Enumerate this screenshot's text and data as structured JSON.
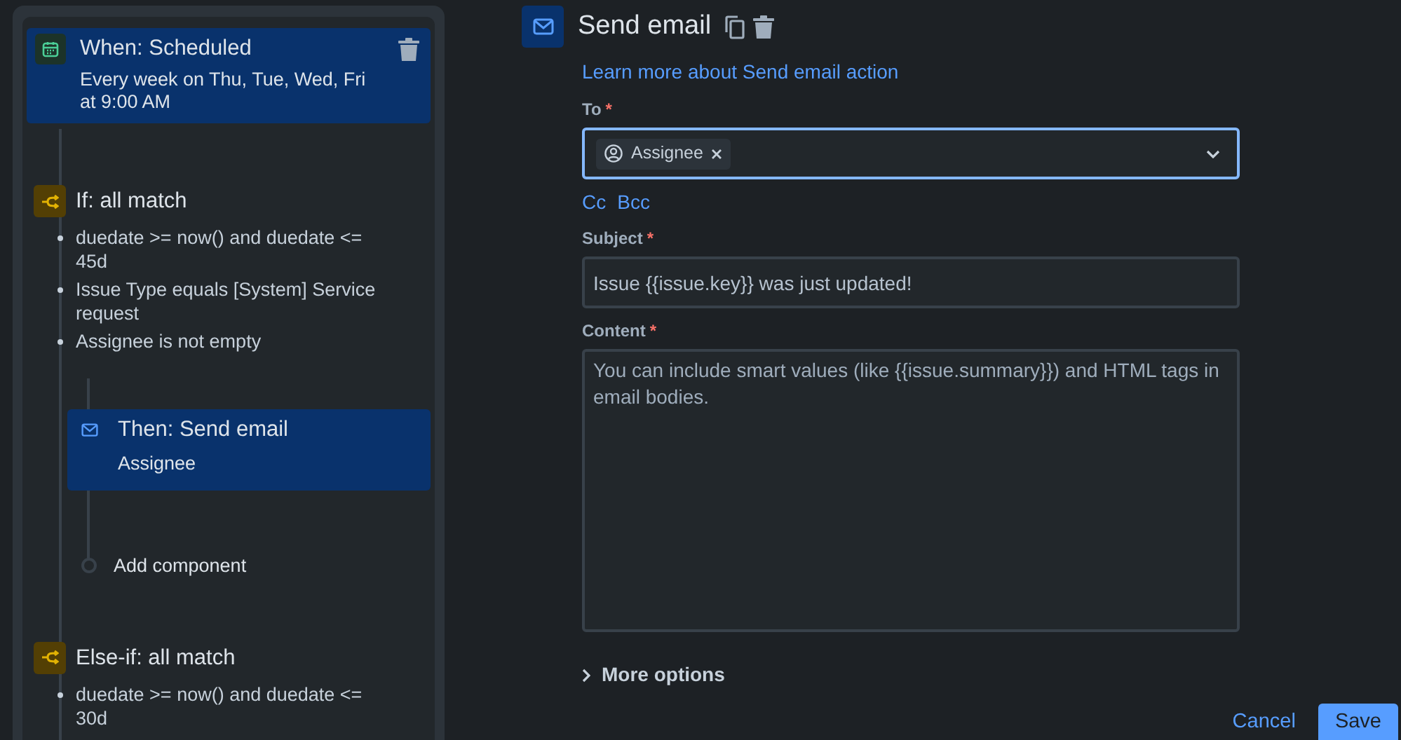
{
  "rule": {
    "components": [
      {
        "kind": "trigger",
        "title": "When: Scheduled",
        "description": "Every week on Thu, Tue, Wed, Fri at 9:00 AM"
      },
      {
        "kind": "condition",
        "title": "If: all match",
        "conditions": [
          "duedate >= now() and duedate <= 45d",
          "Issue Type equals [System] Service request",
          "Assignee is not empty"
        ],
        "children": [
          {
            "kind": "action",
            "title": "Then: Send email",
            "description": "Assignee"
          },
          {
            "kind": "add",
            "title": "Add component"
          }
        ]
      },
      {
        "kind": "condition",
        "title": "Else-if: all match",
        "conditions": [
          "duedate >= now() and duedate <= 30d"
        ]
      }
    ]
  },
  "editor": {
    "title": "Send email",
    "learn_more": "Learn more about Send email action",
    "to": {
      "label": "To",
      "required_mark": "*",
      "focused": true,
      "chips": [
        {
          "label": "Assignee"
        }
      ]
    },
    "cc": "Cc",
    "bcc": "Bcc",
    "subject": {
      "label": "Subject",
      "required_mark": "*",
      "value": "Issue {{issue.key}} was just updated!"
    },
    "content": {
      "label": "Content",
      "required_mark": "*",
      "placeholder": "You can include smart values (like {{issue.summary}}) and HTML tags in email bodies."
    },
    "more_options": {
      "label": "More options",
      "expanded": false
    },
    "buttons": {
      "cancel": "Cancel",
      "save": "Save"
    }
  }
}
